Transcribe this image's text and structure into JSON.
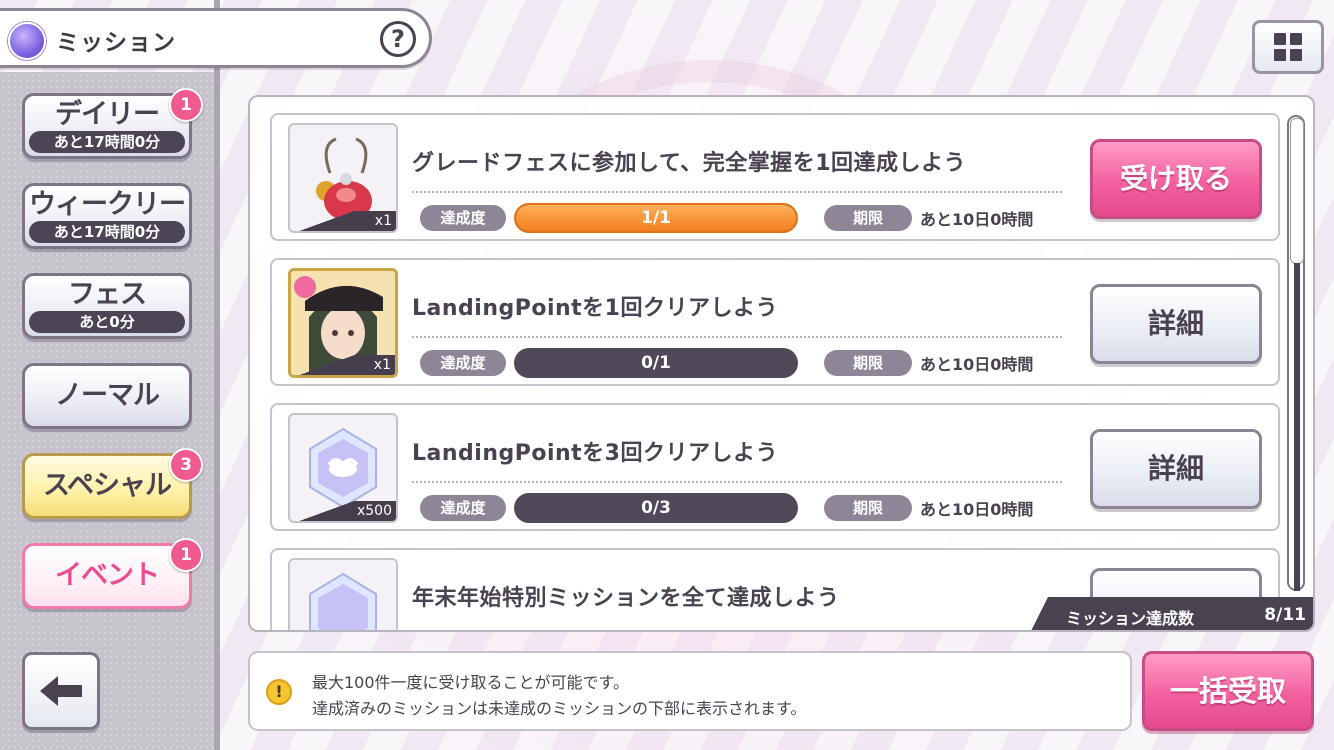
{
  "header": {
    "title": "ミッション",
    "help_label": "?"
  },
  "tabs": [
    {
      "label": "デイリー",
      "sub": "あと17時間0分",
      "badge": "1"
    },
    {
      "label": "ウィークリー",
      "sub": "あと17時間0分"
    },
    {
      "label": "フェス",
      "sub": "あと0分"
    },
    {
      "label": "ノーマル"
    },
    {
      "label": "スペシャル",
      "badge": "3"
    },
    {
      "label": "イベント",
      "badge": "1"
    }
  ],
  "missions": [
    {
      "title": "グレードフェスに参加して、完全掌握を1回達成しよう",
      "reward_count": "x1",
      "progress_label": "達成度",
      "progress_text": "1/1",
      "progress": 1.0,
      "deadline_label": "期限",
      "deadline": "あと10日0時間",
      "action": "受け取る"
    },
    {
      "title": "LandingPointを1回クリアしよう",
      "reward_count": "x1",
      "progress_label": "達成度",
      "progress_text": "0/1",
      "progress": 0.0,
      "deadline_label": "期限",
      "deadline": "あと10日0時間",
      "action": "詳細"
    },
    {
      "title": "LandingPointを3回クリアしよう",
      "reward_count": "x500",
      "progress_label": "達成度",
      "progress_text": "0/3",
      "progress": 0.0,
      "deadline_label": "期限",
      "deadline": "あと10日0時間",
      "action": "詳細"
    },
    {
      "title": "年末年始特別ミッションを全て達成しよう"
    }
  ],
  "summary": {
    "label": "ミッション達成数",
    "value": "8/11"
  },
  "info": {
    "line1": "最大100件一度に受け取ることが可能です。",
    "line2": "達成済みのミッションは未達成のミッションの下部に表示されます。",
    "icon_text": "!"
  },
  "bulk_button": "一括受取",
  "colors": {
    "accent_pink": "#f2609f",
    "progress_orange": "#f27f1e",
    "dark": "#4a4250"
  }
}
